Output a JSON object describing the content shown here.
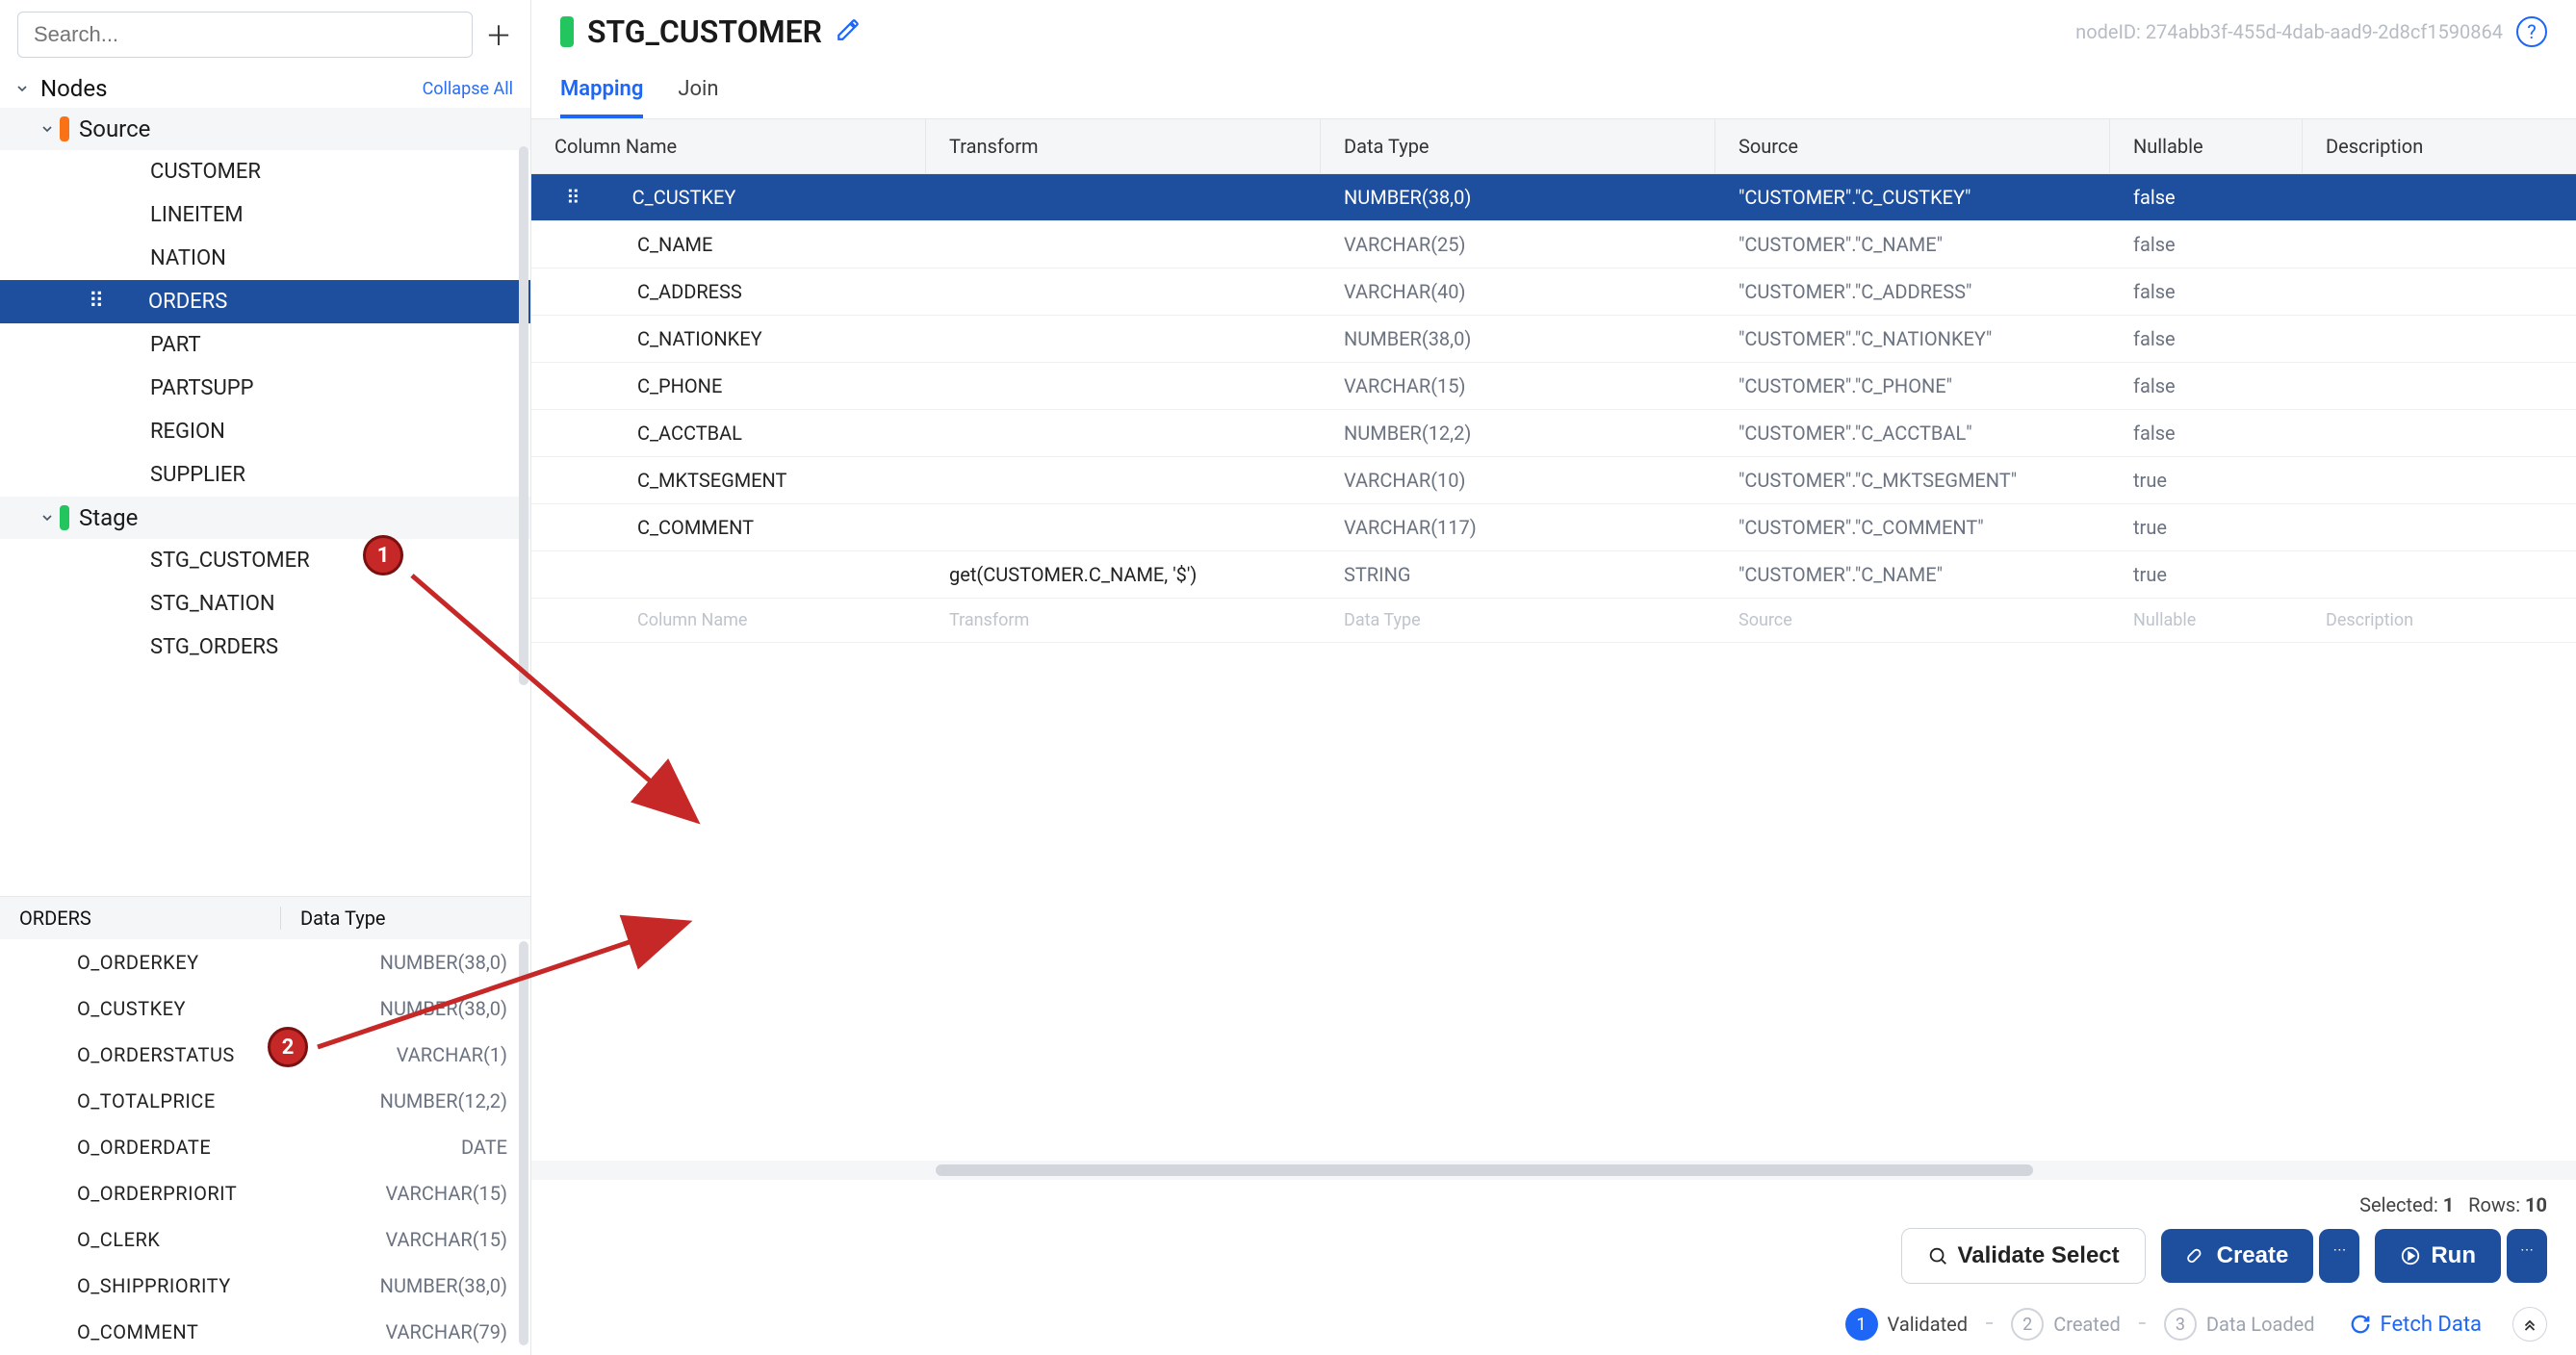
{
  "sidebar": {
    "search_placeholder": "Search...",
    "nodes_label": "Nodes",
    "collapse_all": "Collapse All",
    "groups": [
      {
        "label": "Source",
        "chip": "orange",
        "items": [
          "CUSTOMER",
          "LINEITEM",
          "NATION",
          "ORDERS",
          "PART",
          "PARTSUPP",
          "REGION",
          "SUPPLIER"
        ],
        "selected": "ORDERS"
      },
      {
        "label": "Stage",
        "chip": "green",
        "items": [
          "STG_CUSTOMER",
          "STG_NATION",
          "STG_ORDERS"
        ]
      }
    ],
    "orders_panel": {
      "title": "ORDERS",
      "type_header": "Data Type",
      "columns": [
        {
          "name": "O_ORDERKEY",
          "type": "NUMBER(38,0)"
        },
        {
          "name": "O_CUSTKEY",
          "type": "NUMBER(38,0)"
        },
        {
          "name": "O_ORDERSTATUS",
          "type": "VARCHAR(1)"
        },
        {
          "name": "O_TOTALPRICE",
          "type": "NUMBER(12,2)"
        },
        {
          "name": "O_ORDERDATE",
          "type": "DATE"
        },
        {
          "name": "O_ORDERPRIORIT",
          "type": "VARCHAR(15)"
        },
        {
          "name": "O_CLERK",
          "type": "VARCHAR(15)"
        },
        {
          "name": "O_SHIPPRIORITY",
          "type": "NUMBER(38,0)"
        },
        {
          "name": "O_COMMENT",
          "type": "VARCHAR(79)"
        }
      ]
    }
  },
  "main": {
    "title": "STG_CUSTOMER",
    "nodeid_label": "nodeID: 274abb3f-455d-4dab-aad9-2d8cf1590864",
    "tabs": [
      "Mapping",
      "Join"
    ],
    "active_tab": "Mapping",
    "grid": {
      "headers": [
        "Column Name",
        "Transform",
        "Data Type",
        "Source",
        "Nullable",
        "Description"
      ],
      "rows": [
        {
          "name": "C_CUSTKEY",
          "transform": "",
          "datatype": "NUMBER(38,0)",
          "source": "\"CUSTOMER\".\"C_CUSTKEY\"",
          "nullable": "false",
          "selected": true
        },
        {
          "name": "C_NAME",
          "transform": "",
          "datatype": "VARCHAR(25)",
          "source": "\"CUSTOMER\".\"C_NAME\"",
          "nullable": "false"
        },
        {
          "name": "C_ADDRESS",
          "transform": "",
          "datatype": "VARCHAR(40)",
          "source": "\"CUSTOMER\".\"C_ADDRESS\"",
          "nullable": "false"
        },
        {
          "name": "C_NATIONKEY",
          "transform": "",
          "datatype": "NUMBER(38,0)",
          "source": "\"CUSTOMER\".\"C_NATIONKEY\"",
          "nullable": "false"
        },
        {
          "name": "C_PHONE",
          "transform": "",
          "datatype": "VARCHAR(15)",
          "source": "\"CUSTOMER\".\"C_PHONE\"",
          "nullable": "false"
        },
        {
          "name": "C_ACCTBAL",
          "transform": "",
          "datatype": "NUMBER(12,2)",
          "source": "\"CUSTOMER\".\"C_ACCTBAL\"",
          "nullable": "false"
        },
        {
          "name": "C_MKTSEGMENT",
          "transform": "",
          "datatype": "VARCHAR(10)",
          "source": "\"CUSTOMER\".\"C_MKTSEGMENT\"",
          "nullable": "true"
        },
        {
          "name": "C_COMMENT",
          "transform": "",
          "datatype": "VARCHAR(117)",
          "source": "\"CUSTOMER\".\"C_COMMENT\"",
          "nullable": "true"
        },
        {
          "name": "",
          "transform": "get(CUSTOMER.C_NAME, '$')",
          "datatype": "STRING",
          "source": "\"CUSTOMER\".\"C_NAME\"",
          "nullable": "true"
        }
      ],
      "input_row": {
        "name": "Column Name",
        "transform": "Transform",
        "datatype": "Data Type",
        "source": "Source",
        "nullable": "Nullable",
        "description": "Description"
      }
    },
    "summary": {
      "selected_label": "Selected:",
      "selected": "1",
      "rows_label": "Rows:",
      "rows": "10"
    },
    "footer": {
      "validate": "Validate Select",
      "create": "Create",
      "run": "Run"
    },
    "status": {
      "steps": [
        {
          "num": "1",
          "label": "Validated",
          "active": true
        },
        {
          "num": "2",
          "label": "Created",
          "active": false
        },
        {
          "num": "3",
          "label": "Data Loaded",
          "active": false
        }
      ],
      "fetch": "Fetch Data"
    }
  },
  "annotations": {
    "callout1": "1",
    "callout2": "2"
  }
}
